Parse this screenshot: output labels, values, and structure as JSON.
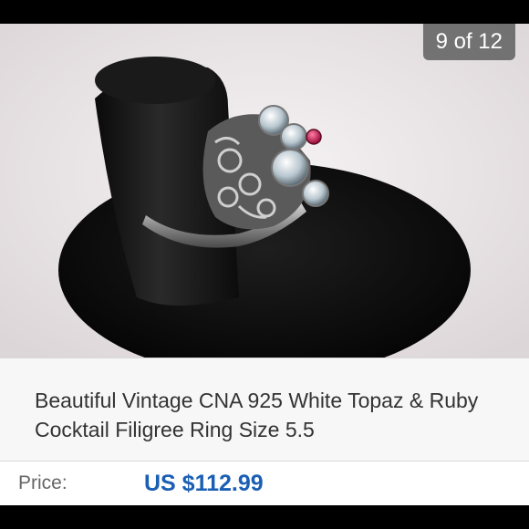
{
  "viewer": {
    "counter_text": "9 of 12",
    "image_alt": "Ring photo"
  },
  "listing": {
    "title": "Beautiful Vintage CNA 925 White Topaz & Ruby Cocktail Filigree  Ring Size 5.5",
    "price_label": "Price:",
    "price_value": "US $112.99"
  },
  "colors": {
    "price_blue": "#1a5fb4",
    "counter_bg": "#5a5a5a",
    "photo_bg": "#efebec"
  }
}
